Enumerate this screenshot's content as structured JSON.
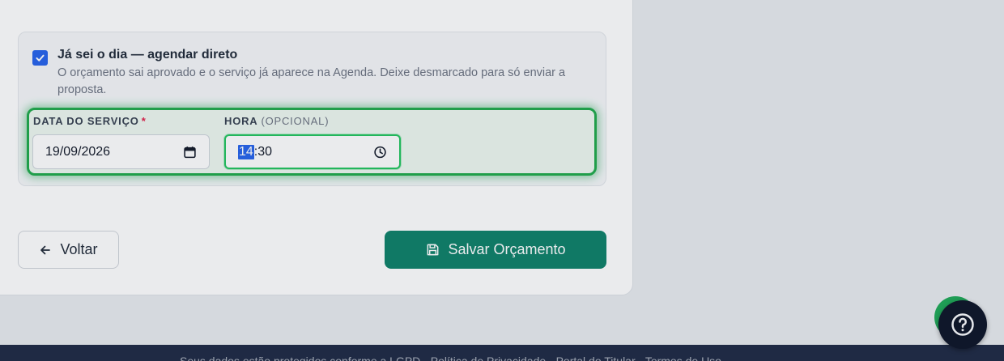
{
  "schedule": {
    "checkbox_checked": true,
    "title": "Já sei o dia — agendar direto",
    "description": "O orçamento sai aprovado e o serviço já aparece na Agenda. Deixe desmarcado para só enviar a proposta."
  },
  "service_date": {
    "label": "DATA DO SERVIÇO",
    "required_mark": "*",
    "value": "19/09/2026"
  },
  "service_time": {
    "label": "HORA",
    "optional_note": "(OPCIONAL)",
    "hour": "14",
    "separator": ":",
    "minute": "30"
  },
  "actions": {
    "back_label": "Voltar",
    "save_label": "Salvar Orçamento"
  },
  "footer": {
    "text": "Seus dados estão protegidos conforme a LGPD · Política de Privacidade · Portal do Titular · Termos de Uso"
  },
  "icons": {
    "checkbox": "check-icon",
    "date": "calendar-icon",
    "time": "clock-icon",
    "back": "arrow-left-icon",
    "save": "floppy-disk-icon",
    "help": "help-circle-icon",
    "footer": "shield-icon"
  },
  "colors": {
    "accent_green": "#1faa4a",
    "save_button": "#0d8068",
    "checkbox_blue": "#2563eb",
    "footer_bg": "#1f2a44"
  }
}
